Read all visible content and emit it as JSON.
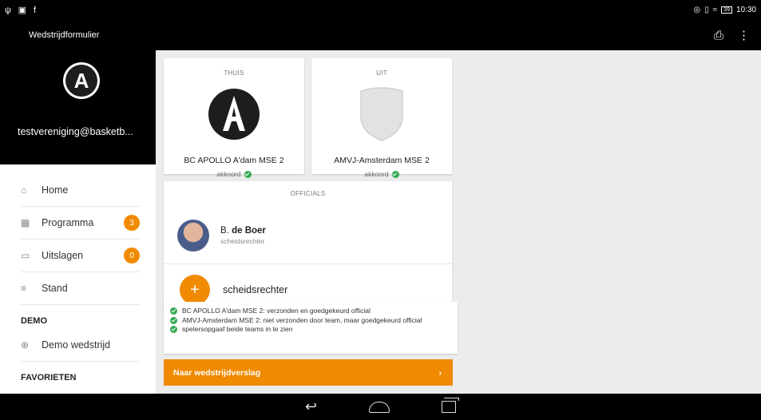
{
  "status": {
    "left_icons": [
      "usb-icon",
      "image-icon",
      "facebook-icon"
    ],
    "time": "10:30",
    "battery": "39"
  },
  "app": {
    "title": "Wedstrijdformulier"
  },
  "sidebar": {
    "email": "testvereniging@basketb...",
    "items": [
      {
        "label": "Home",
        "icon": "home-icon"
      },
      {
        "label": "Programma",
        "icon": "calendar-icon",
        "badge": "3"
      },
      {
        "label": "Uitslagen",
        "icon": "scoreboard-icon",
        "badge": "0"
      },
      {
        "label": "Stand",
        "icon": "list-icon"
      }
    ],
    "sections": [
      {
        "label": "DEMO",
        "items": [
          {
            "label": "Demo wedstrijd",
            "icon": "add-circle-icon"
          }
        ]
      },
      {
        "label": "FAVORIETEN"
      }
    ]
  },
  "teams": {
    "home": {
      "side": "THUIS",
      "name": "BC APOLLO A'dam MSE 2",
      "status": "akkoord"
    },
    "away": {
      "side": "UIT",
      "name": "AMVJ-Amsterdam MSE 2",
      "status": "akkoord"
    }
  },
  "officials": {
    "header": "OFFICIALS",
    "list": [
      {
        "initial": "B.",
        "surname": "de Boer",
        "role": "scheidsrechter"
      }
    ],
    "add_label": "scheidsrechter",
    "add_symbol": "+"
  },
  "messages": [
    "BC APOLLO A'dam MSE 2: verzonden en goedgekeurd official",
    "AMVJ-Amsterdam MSE 2: niet verzonden door team, maar goedgekeurd official",
    "spelersopgaaf beide teams in te zien"
  ],
  "cta": {
    "label": "Naar wedstrijdverslag",
    "arrow": "›"
  },
  "colors": {
    "accent": "#f08a00",
    "success": "#34a853",
    "bar": "#000000"
  }
}
